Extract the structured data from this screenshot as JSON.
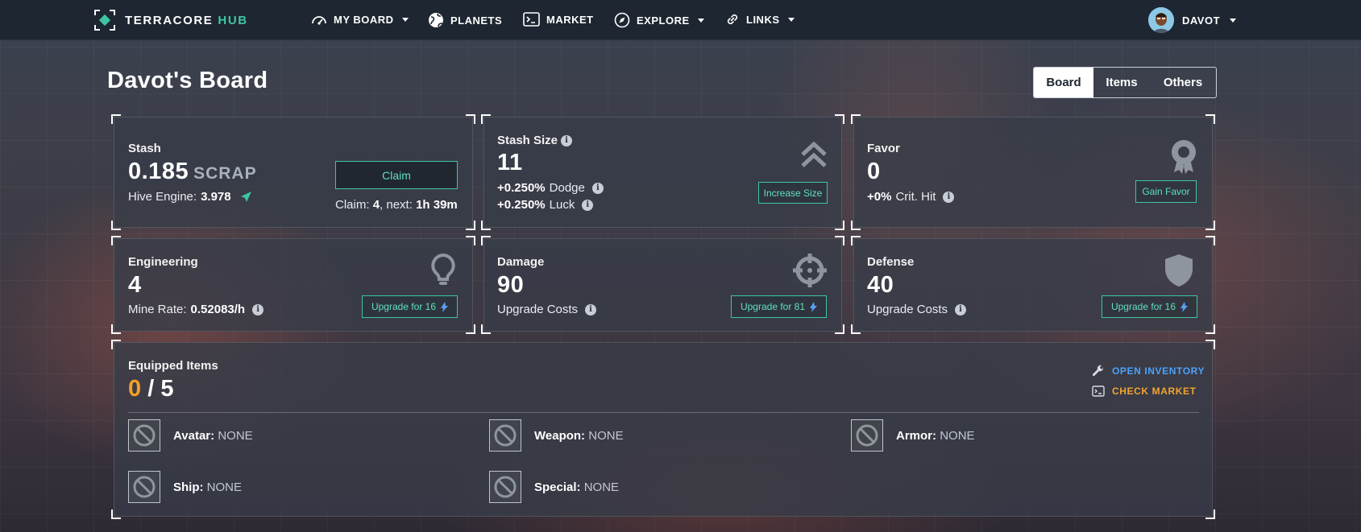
{
  "brand": {
    "name_a": "TERRACORE",
    "name_b": "HUB",
    "accent": "#3fc5a1"
  },
  "nav": {
    "my_board": "MY BOARD",
    "planets": "PLANETS",
    "market": "MARKET",
    "explore": "EXPLORE",
    "links": "LINKS"
  },
  "user": {
    "name": "DAVOT"
  },
  "page": {
    "title": "Davot's Board"
  },
  "tabs": [
    {
      "label": "Board",
      "active": true
    },
    {
      "label": "Items",
      "active": false
    },
    {
      "label": "Others",
      "active": false
    }
  ],
  "stash": {
    "label": "Stash",
    "value": "0.185",
    "unit": "SCRAP",
    "hive_label": "Hive Engine:",
    "hive_value": "3.978",
    "claim_button": "Claim",
    "claim_label": "Claim:",
    "claim_count": "4",
    "next_label": ", next:",
    "next_time": "1h 39m"
  },
  "stash_size": {
    "label": "Stash Size",
    "value": "11",
    "dodge_value": "+0.250%",
    "dodge_label": "Dodge",
    "luck_value": "+0.250%",
    "luck_label": "Luck",
    "button": "Increase Size"
  },
  "favor": {
    "label": "Favor",
    "value": "0",
    "crit_value": "+0%",
    "crit_label": "Crit. Hit",
    "button": "Gain Favor"
  },
  "engineering": {
    "label": "Engineering",
    "value": "4",
    "rate_label": "Mine Rate:",
    "rate_value": "0.52083/h",
    "button": "Upgrade for 16"
  },
  "damage": {
    "label": "Damage",
    "value": "90",
    "costs_label": "Upgrade Costs",
    "button": "Upgrade for 81"
  },
  "defense": {
    "label": "Defense",
    "value": "40",
    "costs_label": "Upgrade Costs",
    "button": "Upgrade for 16"
  },
  "equipped": {
    "label": "Equipped Items",
    "count": "0",
    "separator": "/",
    "total": "5",
    "open_inventory": "OPEN INVENTORY",
    "check_market": "CHECK MARKET",
    "slots": [
      {
        "label": "Avatar:",
        "value": "NONE"
      },
      {
        "label": "Weapon:",
        "value": "NONE"
      },
      {
        "label": "Armor:",
        "value": "NONE"
      },
      {
        "label": "Ship:",
        "value": "NONE"
      },
      {
        "label": "Special:",
        "value": "NONE"
      }
    ]
  },
  "colors": {
    "accent_green": "#3fc5a1",
    "orange": "#f4a02a",
    "blue_link": "#4aa3ff",
    "market_orange": "#f2a530"
  }
}
